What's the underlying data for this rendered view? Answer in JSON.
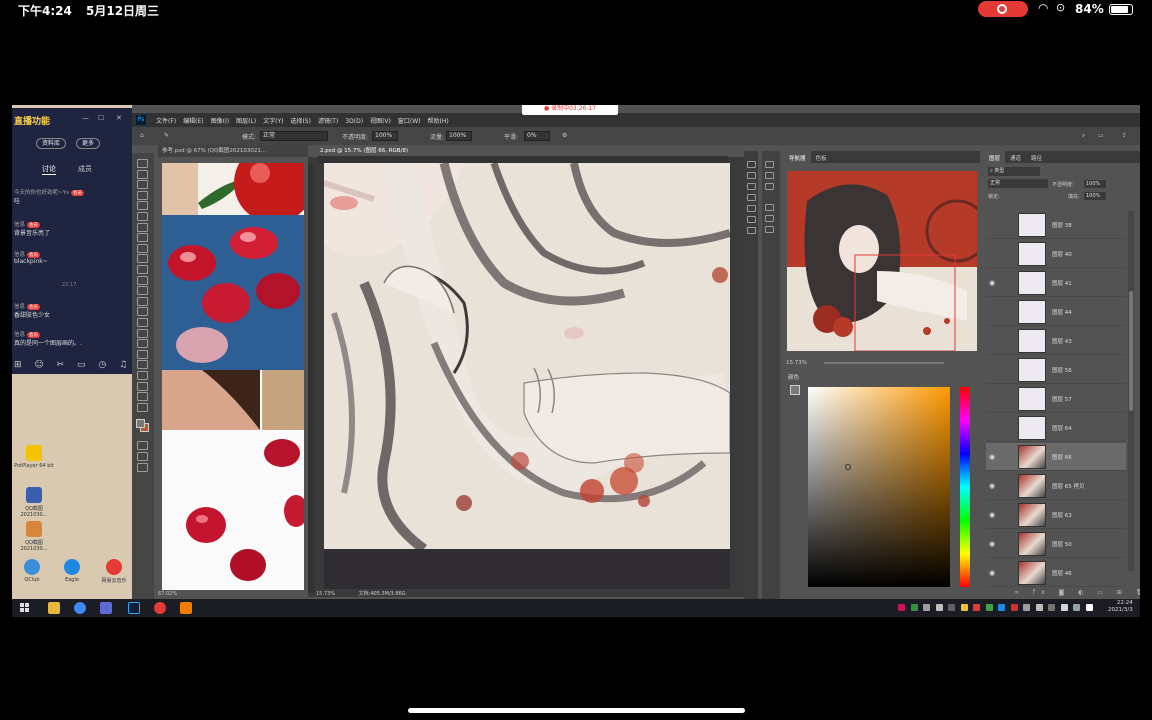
{
  "ios": {
    "time": "下午4:24",
    "date": "5月12日周三",
    "battery": "84%",
    "icons": [
      "record-icon",
      "wifi-icon",
      "rotation-lock-icon",
      "battery-icon"
    ]
  },
  "recording": {
    "label": "● 录制中03:26:17"
  },
  "photoshop": {
    "menus": [
      "文件(F)",
      "编辑(E)",
      "图像(I)",
      "图层(L)",
      "文字(Y)",
      "选择(S)",
      "滤镜(T)",
      "3D(D)",
      "视图(V)",
      "窗口(W)",
      "帮助(H)"
    ],
    "options": {
      "mode_label": "模式:",
      "mode_value": "正常",
      "opacity_label": "不透明度:",
      "opacity_value": "100%",
      "flow_label": "流量:",
      "flow_value": "100%",
      "smooth_label": "平滑:",
      "smooth_value": "0%"
    },
    "doc_tabs": [
      {
        "label": "参考.psd @ 67% (QQ截图202103021..."
      },
      {
        "label": "2.psd @ 15.7% (图层 66, RGB/8)"
      }
    ],
    "doc1_zoom": "67.02%",
    "doc2_zoom": "15.73%",
    "doc2_info": "文档:405.3M/3.86G",
    "navigator": {
      "tabs": [
        "导航器",
        "色板"
      ],
      "zoom": "15.73%"
    },
    "color_panel": {
      "title": "颜色"
    },
    "layers": {
      "tabs": [
        "图层",
        "通道",
        "路径"
      ],
      "filter": "类型",
      "blend": "正常",
      "opacity_label": "不透明度:",
      "opacity_value": "100%",
      "lock_label": "锁定:",
      "fill_label": "填充:",
      "fill_value": "100%",
      "rows": [
        {
          "name": "图层 38",
          "visible": false,
          "art": false
        },
        {
          "name": "图层 40",
          "visible": false,
          "art": false
        },
        {
          "name": "图层 41",
          "visible": true,
          "art": false
        },
        {
          "name": "图层 44",
          "visible": false,
          "art": false
        },
        {
          "name": "图层 43",
          "visible": false,
          "art": false
        },
        {
          "name": "图层 56",
          "visible": false,
          "art": false
        },
        {
          "name": "图层 57",
          "visible": false,
          "art": false
        },
        {
          "name": "图层 64",
          "visible": false,
          "art": false
        },
        {
          "name": "图层 66",
          "visible": true,
          "art": true,
          "selected": true
        },
        {
          "name": "图层 65 拷贝",
          "visible": true,
          "art": true
        },
        {
          "name": "图层 63",
          "visible": true,
          "art": true
        },
        {
          "name": "图层 50",
          "visible": true,
          "art": true
        },
        {
          "name": "图层 46",
          "visible": true,
          "art": true
        }
      ]
    }
  },
  "qq": {
    "title": "直播功能",
    "buttons": [
      "资料库",
      "更多"
    ],
    "tabs": [
      "讨论",
      "成员"
    ],
    "messages": [
      {
        "user": "今天的你也好劲呢~Ys",
        "badge": "会员",
        "text": "哇"
      },
      {
        "user": "信息",
        "badge": "会员",
        "text": "背景音乐亮了"
      },
      {
        "user": "信息",
        "badge": "会员",
        "text": "blackpink~"
      },
      {
        "user": "信息",
        "badge": "会员",
        "text": "香甜肤色少女"
      },
      {
        "user": "信息",
        "badge": "会员",
        "text": "真的是同一个图层画的。."
      }
    ],
    "time_sep": "22:17",
    "toolbar_icons": "⊞ ☺ ✂ ▭ ◷ ♫ ➜"
  },
  "desktop_icons": [
    {
      "label": "PotPlayer 64 bit",
      "color": "#f5c400"
    },
    {
      "label": "QQ截图 2021030...",
      "color": "#3a5fb0"
    },
    {
      "label": "QQ截图 2021030...",
      "color": "#d9863b"
    },
    {
      "label": "QClub",
      "color": "#3b8fd8"
    },
    {
      "label": "Eagle",
      "color": "#1e88e5"
    },
    {
      "label": "网易云音乐",
      "color": "#e53935"
    }
  ],
  "taskbar": {
    "time": "22:24",
    "date": "2021/3/3"
  }
}
